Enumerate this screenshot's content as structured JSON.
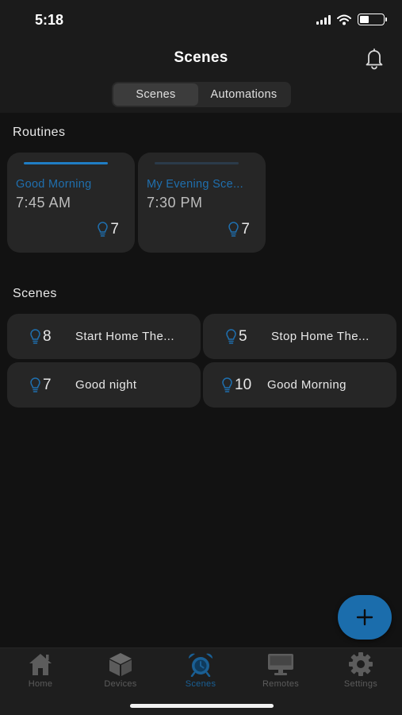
{
  "status_bar": {
    "time": "5:18"
  },
  "header": {
    "title": "Scenes"
  },
  "segmented": {
    "tabs": [
      {
        "label": "Scenes",
        "active": true
      },
      {
        "label": "Automations",
        "active": false
      }
    ]
  },
  "routines": {
    "section_label": "Routines",
    "items": [
      {
        "name": "Good Morning",
        "time": "7:45 AM",
        "device_count": "7"
      },
      {
        "name": "My Evening Sce...",
        "time": "7:30 PM",
        "device_count": "7"
      }
    ]
  },
  "scenes": {
    "section_label": "Scenes",
    "items": [
      {
        "name": "Start Home The...",
        "device_count": "8"
      },
      {
        "name": "Stop Home The...",
        "device_count": "5"
      },
      {
        "name": "Good night",
        "device_count": "7"
      },
      {
        "name": "Good Morning",
        "device_count": "10"
      }
    ]
  },
  "fab": {
    "icon": "plus-icon"
  },
  "tab_bar": {
    "tabs": [
      {
        "label": "Home",
        "icon": "home-icon"
      },
      {
        "label": "Devices",
        "icon": "cube-icon"
      },
      {
        "label": "Scenes",
        "icon": "alarm-clock-icon",
        "active": true
      },
      {
        "label": "Remotes",
        "icon": "monitor-icon"
      },
      {
        "label": "Settings",
        "icon": "gear-icon"
      }
    ]
  },
  "colors": {
    "accent": "#1f6fae",
    "background": "#121212",
    "card": "#262626",
    "tab_inactive": "#5c5c5c"
  }
}
